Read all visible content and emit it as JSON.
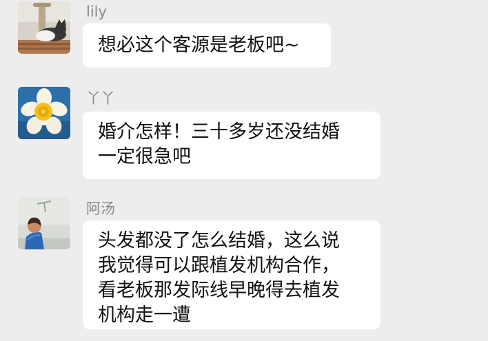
{
  "messages": [
    {
      "sender": "lily",
      "avatar": "cat-avatar",
      "lines": [
        "想必这个客源是老板吧~"
      ]
    },
    {
      "sender": "丫丫",
      "avatar": "daffodil-flower-avatar",
      "lines": [
        "婚介怎样！三十多岁还没结婚",
        "一定很急吧"
      ]
    },
    {
      "sender": "阿汤",
      "avatar": "child-in-blue-jacket-avatar",
      "lines": [
        "头发都没了怎么结婚，这么说",
        "我觉得可以跟植发机构合作，",
        "看老板那发际线早晚得去植发",
        "机构走一遭"
      ]
    }
  ],
  "colors": {
    "background": "#ededed",
    "bubble": "#ffffff",
    "sender_name": "#8a8a8a",
    "message_text": "#111111"
  }
}
